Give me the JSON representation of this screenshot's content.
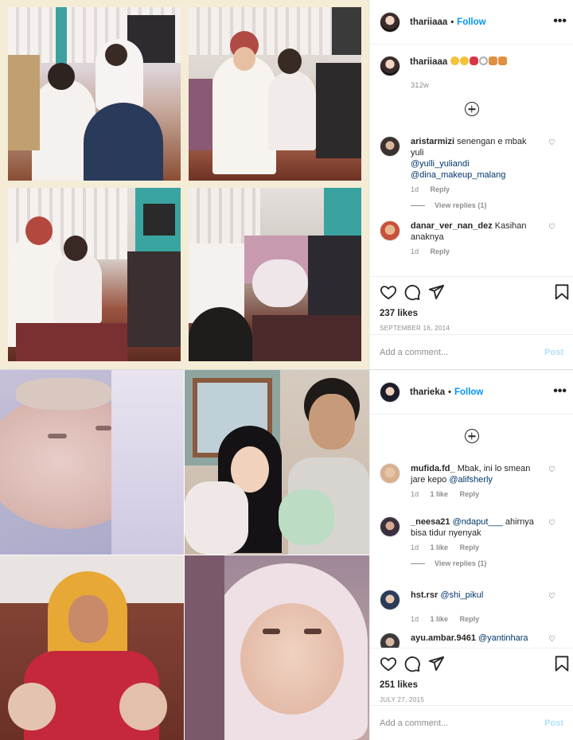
{
  "posts": [
    {
      "username": "thariiaaa",
      "follow_label": "Follow",
      "caption_user": "thariiaaa",
      "caption_emoji": [
        "😊",
        "😊",
        "💋",
        "💍",
        "💑",
        "💑"
      ],
      "caption_age": "312w",
      "comments": [
        {
          "user": "aristarmizi",
          "text": "senengan e mbak yuli",
          "mentions": [
            "@yulli_yuliandi",
            "@dina_makeup_malang"
          ],
          "age": "1d",
          "likes": "",
          "reply": "Reply",
          "view_replies": "View replies (1)"
        },
        {
          "user": "danar_ver_nan_dez",
          "text": "Kasihan anaknya",
          "mentions": [],
          "age": "1d",
          "likes": "",
          "reply": "Reply",
          "view_replies": ""
        }
      ],
      "likes": "237 likes",
      "date": "SEPTEMBER 16, 2014",
      "add_comment_placeholder": "Add a comment...",
      "post_label": "Post"
    },
    {
      "username": "tharieka",
      "follow_label": "Follow",
      "comments": [
        {
          "user": "mufida.fd_",
          "text": "Mbak, ini lo smean jare kepo",
          "mentions": [
            "@alifsherly"
          ],
          "age": "1d",
          "likes": "1 like",
          "reply": "Reply",
          "view_replies": ""
        },
        {
          "user": "_neesa21",
          "text": "",
          "mentions": [
            "@ndaput___"
          ],
          "tail": "ahirnya bisa tidur nyenyak",
          "age": "1d",
          "likes": "1 like",
          "reply": "Reply",
          "view_replies": "View replies (1)"
        },
        {
          "user": "hst.rsr",
          "text": "",
          "mentions": [
            "@shi_pikul"
          ],
          "age": "1d",
          "likes": "1 like",
          "reply": "Reply",
          "view_replies": ""
        },
        {
          "user": "ayu.ambar.9461",
          "text": "",
          "mentions": [
            "@yantinhara"
          ],
          "age": "",
          "likes": "",
          "reply": "",
          "view_replies": ""
        }
      ],
      "likes": "251 likes",
      "date": "JULY 27, 2015",
      "add_comment_placeholder": "Add a comment...",
      "post_label": "Post"
    }
  ],
  "icons": [
    "heart-icon",
    "comment-icon",
    "share-icon",
    "bookmark-icon",
    "more-icon",
    "load-more-icon"
  ]
}
